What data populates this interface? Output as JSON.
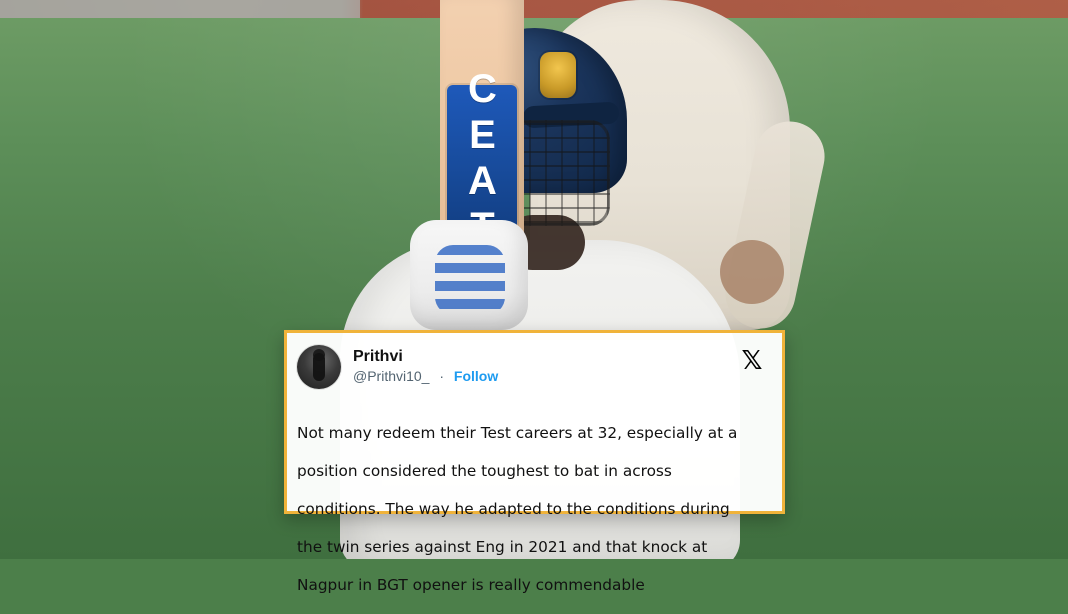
{
  "image": {
    "bat_brand_text": "CEAT"
  },
  "tweet": {
    "display_name": "Prithvi",
    "handle": "@Prithvi10_",
    "separator": "·",
    "follow_label": "Follow",
    "platform_icon": "x-icon",
    "text_lines": [
      "Not many redeem their Test careers at 32, especially at a",
      "position considered the toughest to bat in across",
      "conditions. The way he adapted to the conditions during",
      "the twin series against Eng in 2021 and that knock at",
      "Nagpur in BGT opener  is really commendable"
    ]
  },
  "colors": {
    "tweet_border": "#f0b33a",
    "link_blue": "#1d9bf0"
  }
}
